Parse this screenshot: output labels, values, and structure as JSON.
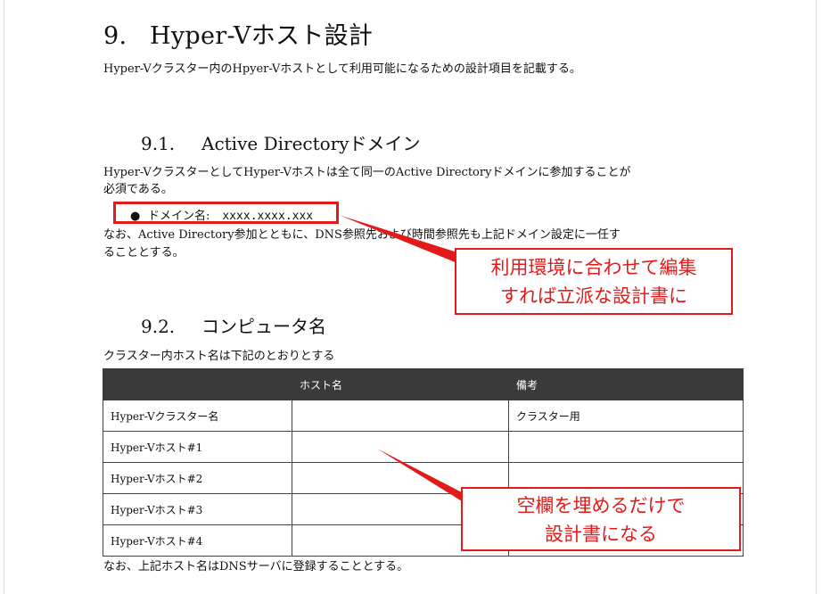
{
  "heading": {
    "number": "9.",
    "title": "Hyper-Vホスト設計"
  },
  "intro": "Hyper-Vクラスター内のHpyer-Vホストとして利用可能になるための設計項目を記載する。",
  "section_91": {
    "number": "9.1.",
    "title": "Active Directoryドメイン",
    "para_line1": "Hyper-VクラスターとしてHyper-Vホストは全て同一のActive Directoryドメインに参加することが",
    "para_line2": "必須である。",
    "bullet_label": "ドメイン名:",
    "bullet_value": "xxxx.xxxx.xxx",
    "note_line1": "なお、Active Directory参加とともに、DNS参照先および時間参照先も上記ドメイン設定に一任す",
    "note_line2": "ることとする。"
  },
  "section_92": {
    "number": "9.2.",
    "title": "コンピュータ名",
    "para": "クラスター内ホスト名は下記のとおりとする",
    "table": {
      "headers": [
        "",
        "ホスト名",
        "備考"
      ],
      "rows": [
        [
          "Hyper-Vクラスター名",
          "",
          "クラスター用"
        ],
        [
          "Hyper-Vホスト#1",
          "",
          ""
        ],
        [
          "Hyper-Vホスト#2",
          "",
          ""
        ],
        [
          "Hyper-Vホスト#3",
          "",
          ""
        ],
        [
          "Hyper-Vホスト#4",
          "",
          ""
        ]
      ]
    },
    "footer": "なお、上記ホスト名はDNSサーバに登録することとする。"
  },
  "callouts": {
    "first_line1": "利用環境に合わせて編集",
    "first_line2": "すれば立派な設計書に",
    "second_line1": "空欄を埋めるだけで",
    "second_line2": "設計書になる"
  },
  "colors": {
    "accent_red": "#e31a1a",
    "table_header_bg": "#3a3a3a"
  }
}
